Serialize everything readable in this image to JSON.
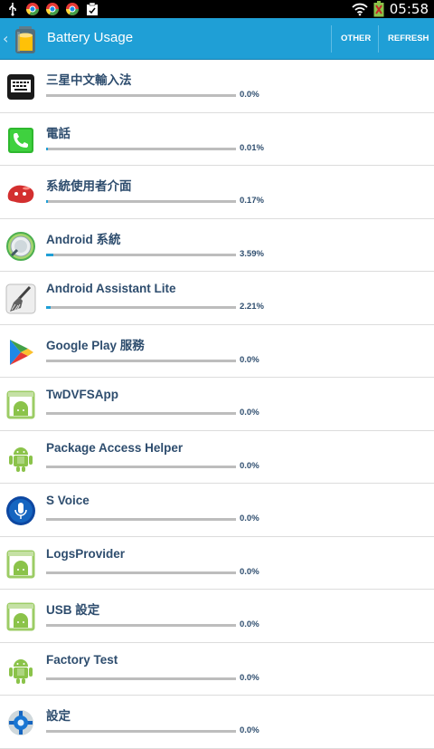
{
  "status_bar": {
    "time": "05:58",
    "icons": [
      "usb-icon",
      "chrome-icon",
      "chrome-icon",
      "chrome-icon",
      "clipboard-icon",
      "wifi-icon",
      "battery-icon"
    ]
  },
  "action_bar": {
    "title": "Battery Usage",
    "other_label": "OTHER",
    "refresh_label": "REFRESH",
    "accent_color": "#1f9fd6"
  },
  "apps": [
    {
      "name": "三星中文輸入法",
      "percent": "0.0%",
      "usage_fraction": 0.0,
      "icon": "keyboard-icon"
    },
    {
      "name": "電話",
      "percent": "0.01%",
      "usage_fraction": 0.0001,
      "icon": "phone-icon"
    },
    {
      "name": "系統使用者介面",
      "percent": "0.17%",
      "usage_fraction": 0.0017,
      "icon": "jellybean-icon"
    },
    {
      "name": "Android 系統",
      "percent": "3.59%",
      "usage_fraction": 0.0359,
      "icon": "android-system-icon"
    },
    {
      "name": "Android Assistant Lite",
      "percent": "2.21%",
      "usage_fraction": 0.0221,
      "icon": "broom-icon"
    },
    {
      "name": "Google Play 服務",
      "percent": "0.0%",
      "usage_fraction": 0.0,
      "icon": "play-services-icon"
    },
    {
      "name": "TwDVFSApp",
      "percent": "0.0%",
      "usage_fraction": 0.0,
      "icon": "apk-icon"
    },
    {
      "name": "Package Access Helper",
      "percent": "0.0%",
      "usage_fraction": 0.0,
      "icon": "android-robot-icon"
    },
    {
      "name": "S Voice",
      "percent": "0.0%",
      "usage_fraction": 0.0,
      "icon": "microphone-icon"
    },
    {
      "name": "LogsProvider",
      "percent": "0.0%",
      "usage_fraction": 0.0,
      "icon": "apk-icon"
    },
    {
      "name": "USB 設定",
      "percent": "0.0%",
      "usage_fraction": 0.0,
      "icon": "apk-icon"
    },
    {
      "name": "Factory Test",
      "percent": "0.0%",
      "usage_fraction": 0.0,
      "icon": "android-robot-icon"
    },
    {
      "name": "設定",
      "percent": "0.0%",
      "usage_fraction": 0.0,
      "icon": "settings-gear-icon"
    }
  ]
}
